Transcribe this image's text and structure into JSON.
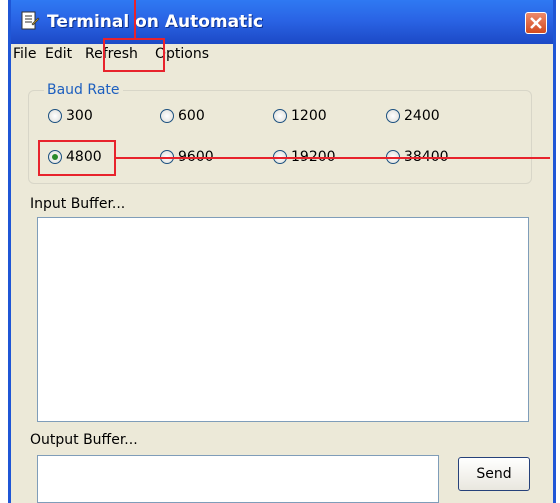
{
  "window": {
    "title": "Terminal on Automatic",
    "icon": "document-icon",
    "close_icon": "close-icon"
  },
  "menu": {
    "items": [
      {
        "label": "File"
      },
      {
        "label": "Edit"
      },
      {
        "label": "Refresh"
      },
      {
        "label": "Options"
      }
    ]
  },
  "baud_rate": {
    "label": "Baud Rate",
    "options": [
      {
        "label": "300",
        "checked": false
      },
      {
        "label": "600",
        "checked": false
      },
      {
        "label": "1200",
        "checked": false
      },
      {
        "label": "2400",
        "checked": false
      },
      {
        "label": "4800",
        "checked": true
      },
      {
        "label": "9600",
        "checked": false
      },
      {
        "label": "19200",
        "checked": false
      },
      {
        "label": "38400",
        "checked": false
      }
    ],
    "selected": "4800"
  },
  "input_buffer": {
    "label": "Input Buffer...",
    "value": ""
  },
  "output_buffer": {
    "label": "Output Buffer...",
    "value": ""
  },
  "send_button": {
    "label": "Send"
  },
  "colors": {
    "titlebar": "#2a64e5",
    "window_bg": "#ece9d8",
    "annotation": "#e8232c",
    "group_label": "#1d5fbf"
  }
}
